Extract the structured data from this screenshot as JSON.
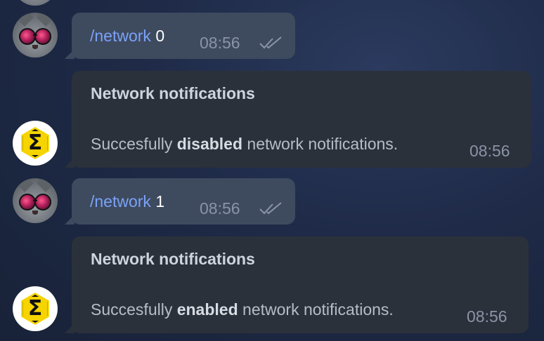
{
  "messages": [
    {
      "sender": "user",
      "command": "/network",
      "arg": "0",
      "time": "08:56",
      "status_icon": "double-check-icon"
    },
    {
      "sender": "bot",
      "title": "Network notifications",
      "text_prefix": "Succesfully ",
      "text_bold": "disabled",
      "text_suffix": " network notifications.",
      "time": "08:56"
    },
    {
      "sender": "user",
      "command": "/network",
      "arg": "1",
      "time": "08:56",
      "status_icon": "double-check-icon"
    },
    {
      "sender": "bot",
      "title": "Network notifications",
      "text_prefix": "Succesfully ",
      "text_bold": "enabled",
      "text_suffix": " network notifications.",
      "time": "08:56"
    }
  ],
  "colors": {
    "background": "#1e2a47",
    "outgoing_bubble": "#3e4a5e",
    "incoming_bubble": "#2b313b",
    "command_link": "#7aa2f7",
    "bot_logo": "#f5d400"
  }
}
